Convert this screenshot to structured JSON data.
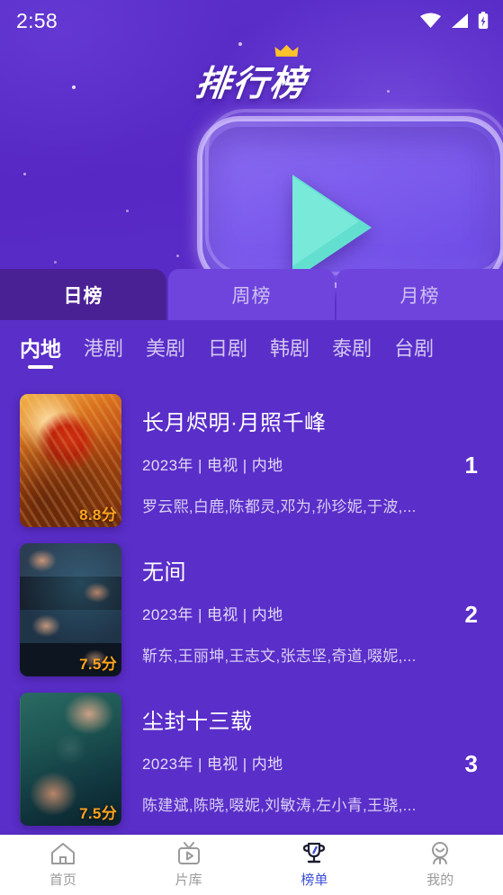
{
  "status_bar": {
    "time": "2:58",
    "icons": [
      "wifi-icon",
      "cellular-signal-icon",
      "battery-charging-icon"
    ]
  },
  "banner": {
    "title": "排行榜",
    "crown_color": "#ffc22b",
    "background_color": "#5a2ec9",
    "art": {
      "name": "play-button-3d",
      "triangle_color": "#63dfd0",
      "slab_color": "#8164ee"
    }
  },
  "period_tabs": {
    "active_index": 0,
    "items": [
      {
        "label": "日榜"
      },
      {
        "label": "周榜"
      },
      {
        "label": "月榜"
      }
    ],
    "active_bg": "#4a2194",
    "inactive_bg": "#6f44dd"
  },
  "category_tabs": {
    "active_index": 0,
    "items": [
      {
        "label": "内地"
      },
      {
        "label": "港剧"
      },
      {
        "label": "美剧"
      },
      {
        "label": "日剧"
      },
      {
        "label": "韩剧"
      },
      {
        "label": "泰剧"
      },
      {
        "label": "台剧"
      }
    ]
  },
  "list": {
    "items": [
      {
        "rank": "1",
        "title": "长月烬明·月照千峰",
        "meta": "2023年 | 电视 | 内地",
        "cast": "罗云熙,白鹿,陈都灵,邓为,孙珍妮,于波,...",
        "score": "8.8分",
        "poster_style": "fire-artwork"
      },
      {
        "rank": "2",
        "title": "无间",
        "meta": "2023年 | 电视 | 内地",
        "cast": "靳东,王丽坤,王志文,张志坚,奇道,啜妮,...",
        "score": "7.5分",
        "poster_style": "four-band-portraits"
      },
      {
        "rank": "3",
        "title": "尘封十三载",
        "meta": "2023年 | 电视 | 内地",
        "cast": "陈建斌,陈晓,啜妮,刘敏涛,左小青,王骁,...",
        "score": "7.5分",
        "poster_style": "teal-portraits"
      }
    ],
    "score_color": "#ffa320"
  },
  "bottom_nav": {
    "active_index": 2,
    "active_color": "#3c4fd6",
    "inactive_color": "#9a9a9a",
    "items": [
      {
        "label": "首页",
        "icon": "home-icon"
      },
      {
        "label": "片库",
        "icon": "tv-icon"
      },
      {
        "label": "榜单",
        "icon": "trophy-icon"
      },
      {
        "label": "我的",
        "icon": "user-icon"
      }
    ]
  }
}
